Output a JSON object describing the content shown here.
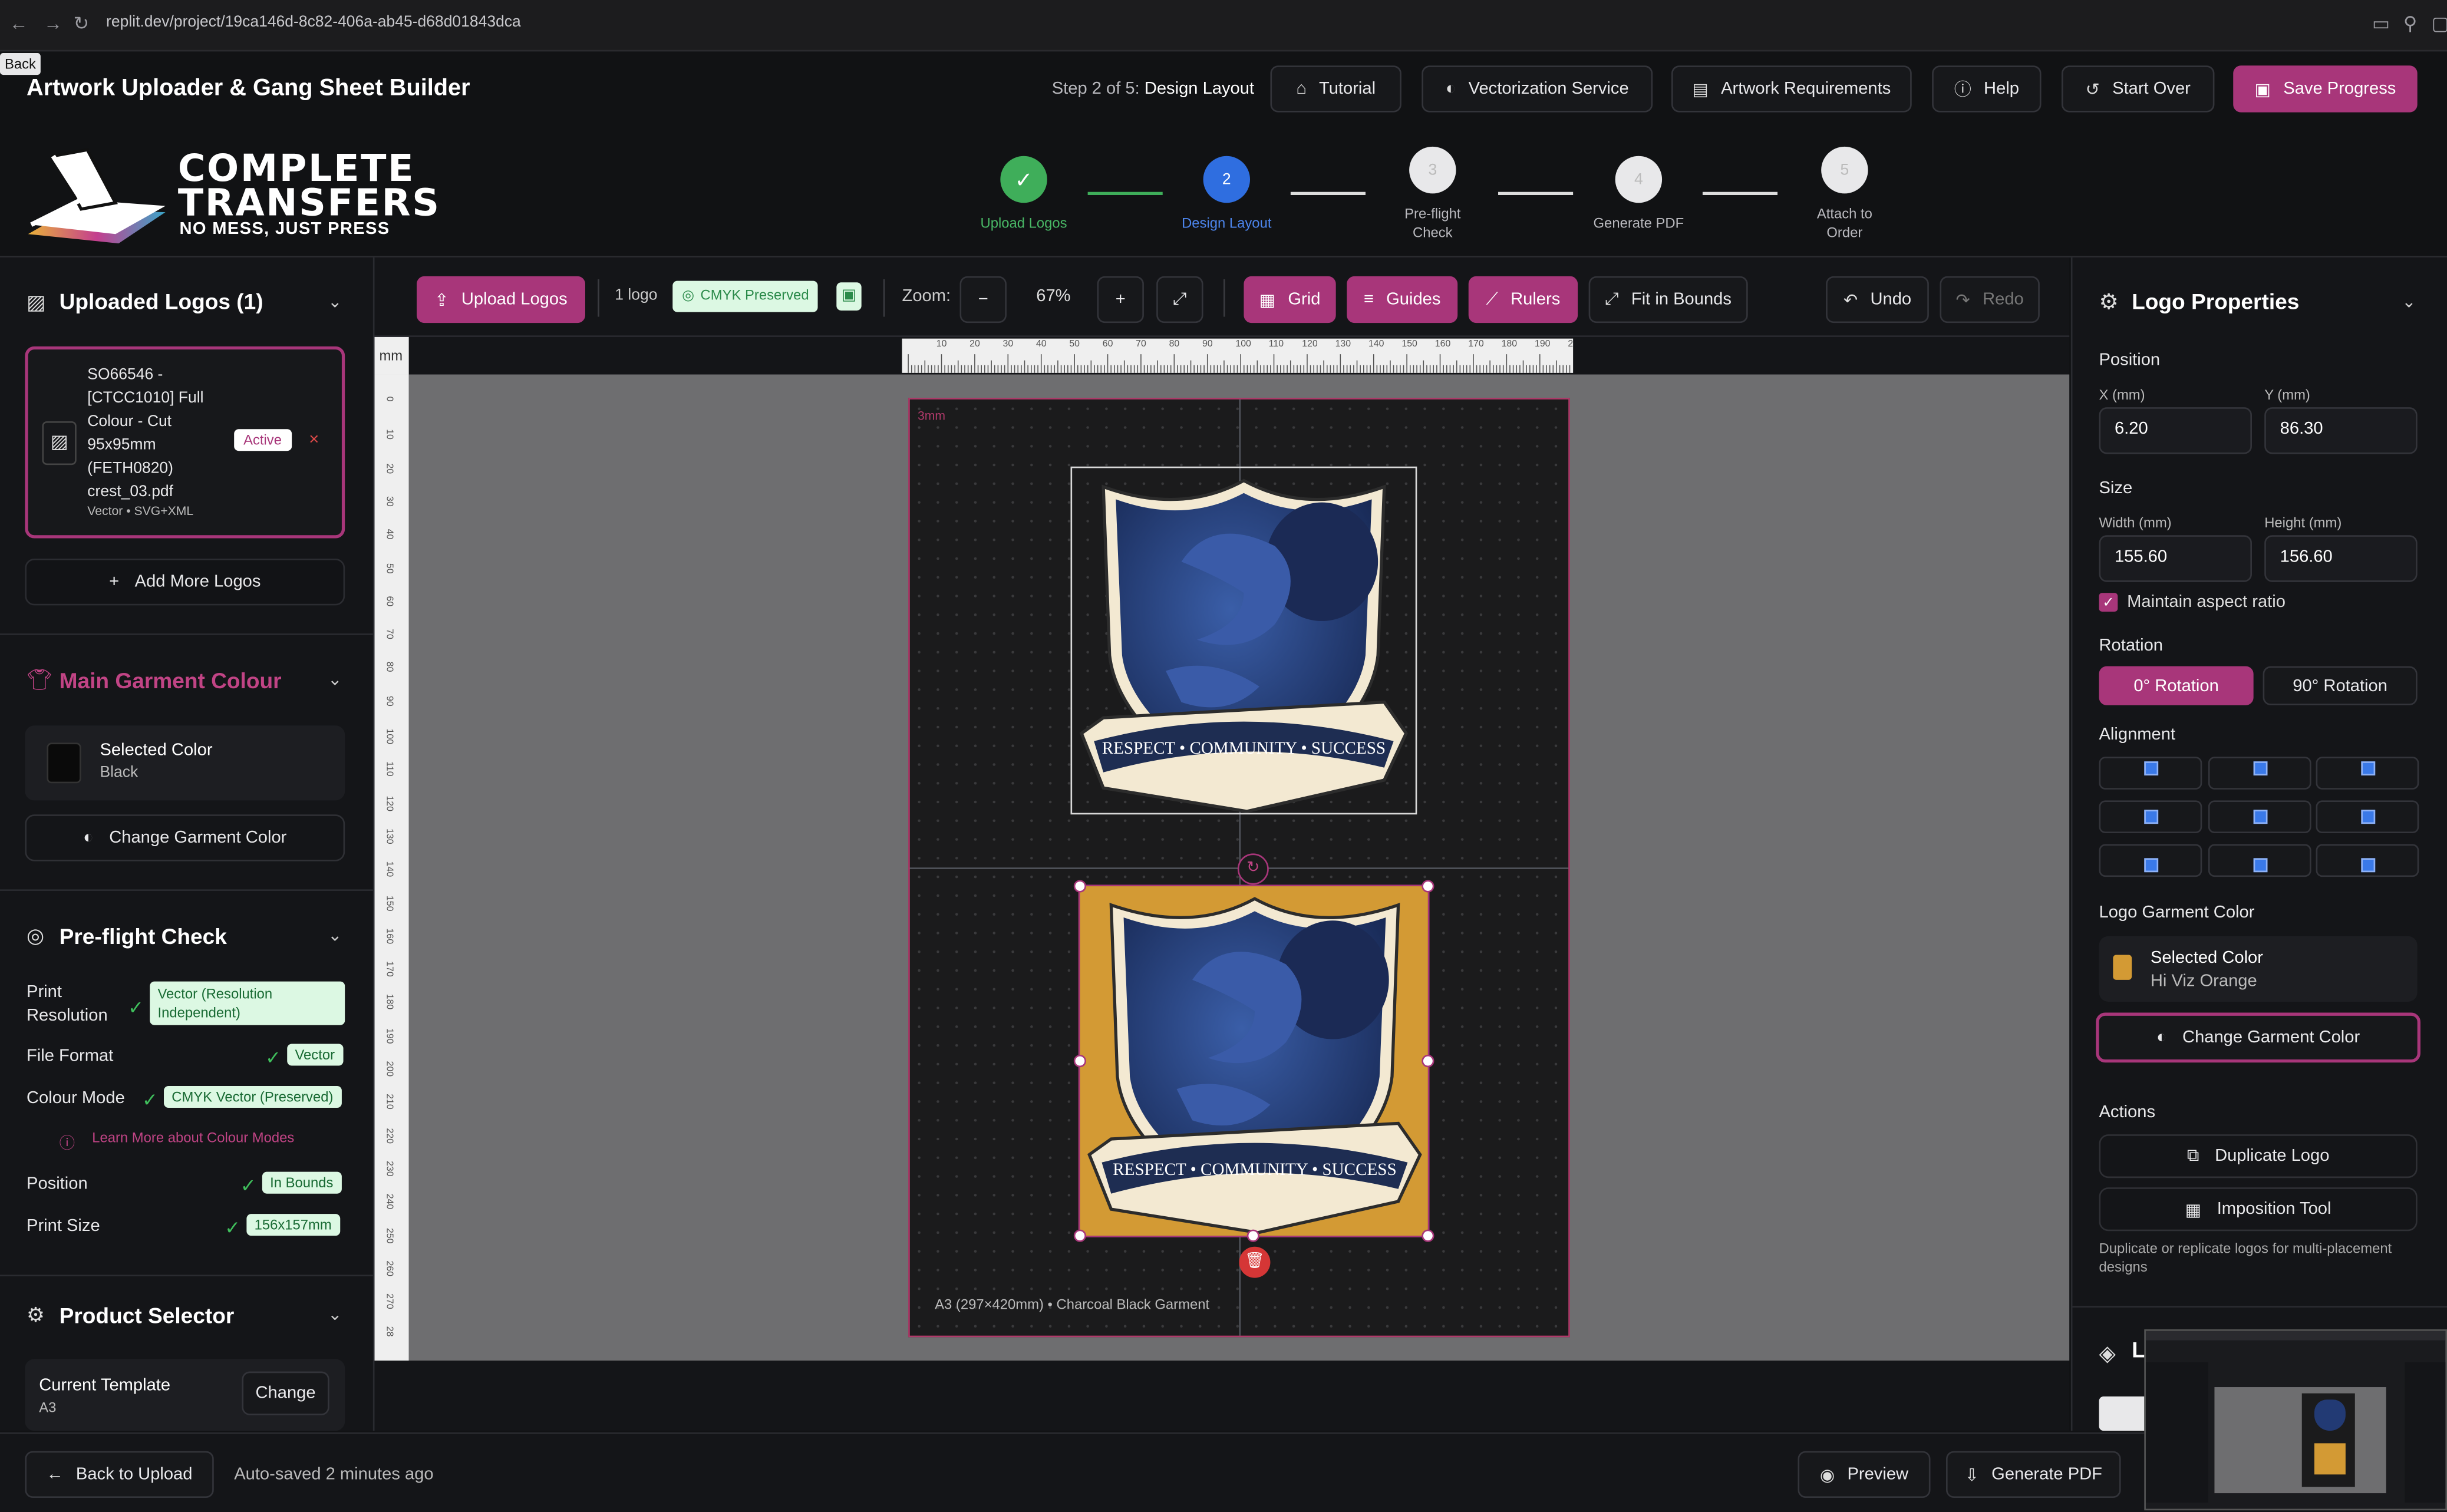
{
  "browser": {
    "url": "replit.dev/project/19ca146d-8c82-406a-ab45-d68d01843dca",
    "tooltip": "Back"
  },
  "header": {
    "title": "Artwork Uploader & Gang Sheet Builder",
    "step_prefix": "Step 2 of 5:",
    "step_name": "Design Layout",
    "buttons": {
      "tutorial": "Tutorial",
      "vectorization": "Vectorization Service",
      "requirements": "Artwork Requirements",
      "help": "Help",
      "start_over": "Start Over",
      "save": "Save Progress"
    }
  },
  "brand": {
    "line1": "COMPLETE",
    "line2": "TRANSFERS",
    "tagline": "NO MESS, JUST PRESS"
  },
  "stepper": [
    {
      "num": "✓",
      "label": "Upload Logos",
      "status": "done"
    },
    {
      "num": "2",
      "label": "Design Layout",
      "status": "active"
    },
    {
      "num": "3",
      "label": "Pre-flight Check",
      "status": "pending"
    },
    {
      "num": "4",
      "label": "Generate PDF",
      "status": "pending"
    },
    {
      "num": "5",
      "label": "Attach to Order",
      "status": "pending"
    }
  ],
  "left": {
    "uploaded_title": "Uploaded Logos (1)",
    "logo": {
      "name": "SO66546 - [CTCC1010] Full Colour - Cut 95x95mm (FETH0820) crest_03.pdf",
      "meta": "Vector • SVG+XML",
      "badge": "Active"
    },
    "add_more": "Add More Logos",
    "garment_title": "Main Garment Colour",
    "selected_color_label": "Selected Color",
    "selected_color_value": "Black",
    "change_garment": "Change Garment Color",
    "preflight_title": "Pre-flight Check",
    "preflight": {
      "print_res_label": "Print Resolution",
      "print_res_value": "Vector (Resolution Independent)",
      "file_format_label": "File Format",
      "file_format_value": "Vector",
      "colour_mode_label": "Colour Mode",
      "colour_mode_value": "CMYK Vector (Preserved)",
      "learn_more": "Learn More about Colour Modes",
      "position_label": "Position",
      "position_value": "In Bounds",
      "print_size_label": "Print Size",
      "print_size_value": "156x157mm"
    },
    "product_title": "Product Selector",
    "template_label": "Current Template",
    "template_value": "A3",
    "change": "Change"
  },
  "toolbar": {
    "upload": "Upload Logos",
    "count": "1 logo",
    "cmyk": "CMYK Preserved",
    "zoom_label": "Zoom:",
    "zoom_value": "67%",
    "grid": "Grid",
    "guides": "Guides",
    "rulers": "Rulers",
    "fit": "Fit in Bounds",
    "undo": "Undo",
    "redo": "Redo"
  },
  "canvas": {
    "unit": "mm",
    "margin_label": "3mm",
    "footer": "A3 (297×420mm) • Charcoal Black Garment",
    "ruler_top": [
      "10",
      "20",
      "30",
      "40",
      "50",
      "60",
      "70",
      "80",
      "90",
      "100",
      "110",
      "120",
      "130",
      "140",
      "150",
      "160",
      "170",
      "180",
      "190",
      "2"
    ],
    "ruler_left": [
      "0",
      "10",
      "20",
      "30",
      "40",
      "50",
      "60",
      "70",
      "80",
      "90",
      "100",
      "110",
      "120",
      "130",
      "140",
      "150",
      "160",
      "170",
      "180",
      "190",
      "200",
      "210",
      "220",
      "230",
      "240",
      "250",
      "260",
      "270",
      "28"
    ],
    "crest_text": "RESPECT • COMMUNITY • SUCCESS",
    "colors": {
      "orange": "#d39a34",
      "navy": "#223a74",
      "pink": "#a8367a"
    }
  },
  "right": {
    "title": "Logo Properties",
    "position": "Position",
    "x_label": "X (mm)",
    "x_value": "6.20",
    "y_label": "Y (mm)",
    "y_value": "86.30",
    "size": "Size",
    "w_label": "Width (mm)",
    "w_value": "155.60",
    "h_label": "Height (mm)",
    "h_value": "156.60",
    "aspect": "Maintain aspect ratio",
    "rotation": "Rotation",
    "rot0": "0° Rotation",
    "rot90": "90° Rotation",
    "alignment": "Alignment",
    "logo_garment": "Logo Garment Color",
    "selected_color_label": "Selected Color",
    "selected_color_value": "Hi Viz Orange",
    "change_garment": "Change Garment Color",
    "actions": "Actions",
    "duplicate": "Duplicate Logo",
    "imposition": "Imposition Tool",
    "help_text": "Duplicate or replicate logos for multi-placement designs",
    "layers_partial": "L"
  },
  "bottom": {
    "back": "Back to Upload",
    "autosave": "Auto-saved 2 minutes ago",
    "preview": "Preview",
    "generate": "Generate PDF"
  }
}
